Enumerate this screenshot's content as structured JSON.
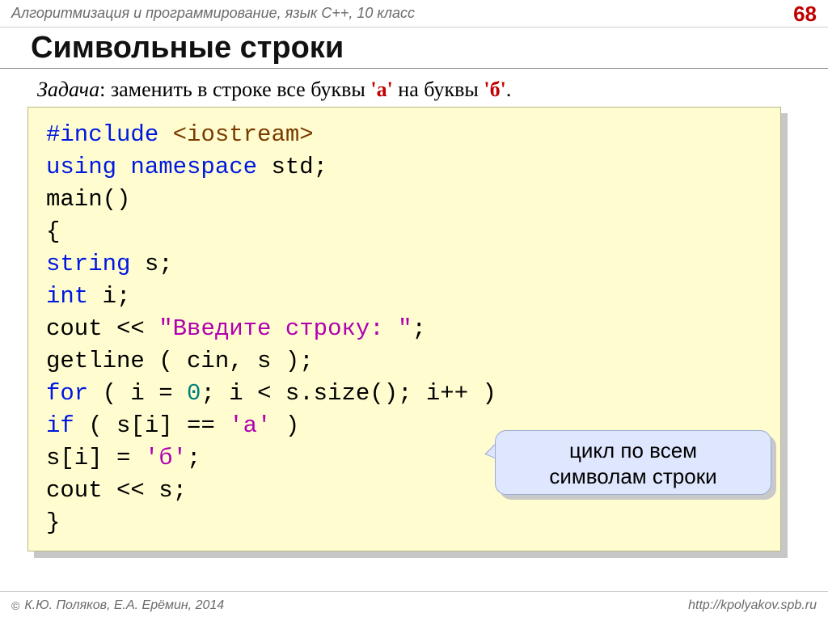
{
  "header": {
    "course": "Алгоритмизация и программирование, язык C++, 10 класс",
    "page": "68"
  },
  "title": "Символьные строки",
  "task": {
    "label": "Задача",
    "sep": ": ",
    "before": "заменить в строке все буквы ",
    "hl1": "'а'",
    "mid": " на буквы ",
    "hl2": "'б'",
    "tail": "."
  },
  "code": {
    "l1_a": "#include ",
    "l1_b": "<iostream>",
    "l2_a": "using ",
    "l2_b": "namespace ",
    "l2_c": "std;",
    "l3": "main()",
    "l4": "{",
    "l5_a": "   string ",
    "l5_b": "s;",
    "l6_a": "   int ",
    "l6_b": "i;",
    "l7_a": "   cout << ",
    "l7_b": "\"Введите строку: \"",
    "l7_c": ";",
    "l8": "   getline ( cin, s );",
    "l9_a": "   for ",
    "l9_b": "( i = ",
    "l9_c": "0",
    "l9_d": "; i < s.size(); i++ )",
    "l10_a": "     if ",
    "l10_b": "( s[i] == ",
    "l10_c": "'а'",
    "l10_d": " )",
    "l11_a": "       s[i] = ",
    "l11_b": "'б'",
    "l11_c": ";",
    "l12": "   cout << s;",
    "l13": "}"
  },
  "callout": {
    "line1": "цикл по всем",
    "line2": "символам строки"
  },
  "footer": {
    "copyright": "©",
    "authors": "К.Ю. Поляков, Е.А. Ерёмин, 2014",
    "url": "http://kpolyakov.spb.ru"
  }
}
